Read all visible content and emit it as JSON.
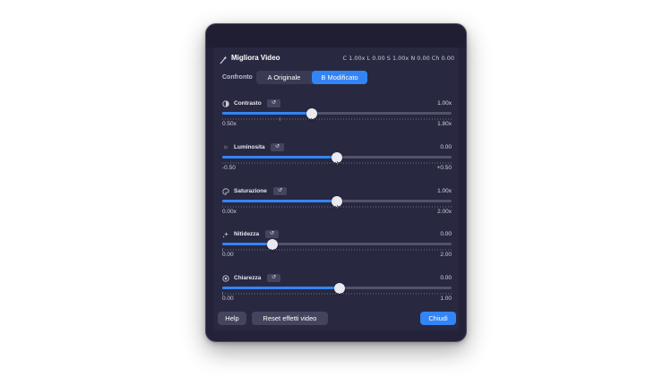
{
  "header": {
    "title": "Migliora Video",
    "stats": "C 1.00x   L 0.00   S 1.00x   N 0.00   Ch 0.00",
    "icon": "magic-wand-icon"
  },
  "compare": {
    "label": "Confronto",
    "options": [
      "A Originale",
      "B Modificato"
    ],
    "selected": "B Modificato"
  },
  "sliders": [
    {
      "id": "contrasto",
      "label": "Contrasto",
      "icon": "contrast-icon",
      "value": "1.00x",
      "min": "0.50x",
      "max": "1.80x",
      "level": 0.39
    },
    {
      "id": "luminosita",
      "label": "Luminosita",
      "icon": "sun-icon",
      "value": "0.00",
      "min": "-0.50",
      "max": "+0.50",
      "level": 0.5
    },
    {
      "id": "saturazione",
      "label": "Saturazione",
      "icon": "palette-icon",
      "value": "1.00x",
      "min": "0.00x",
      "max": "2.00x",
      "level": 0.5
    },
    {
      "id": "nitidezza",
      "label": "Nitidezza",
      "icon": "sparkle-icon",
      "value": "0.00",
      "min": "0.00",
      "max": "2.00",
      "level": 0.22
    },
    {
      "id": "chiarezza",
      "label": "Chiarezza",
      "icon": "aperture-icon",
      "value": "0.00",
      "min": "0.00",
      "max": "1.00",
      "level": 0.51
    }
  ],
  "reset_glyph": "↺",
  "footer": {
    "help": "Help",
    "reset_effects": "Reset effetti video",
    "close": "Chiudi"
  },
  "colors": {
    "accent": "#3384f5",
    "panel": "#292841",
    "window": "#23223a"
  }
}
